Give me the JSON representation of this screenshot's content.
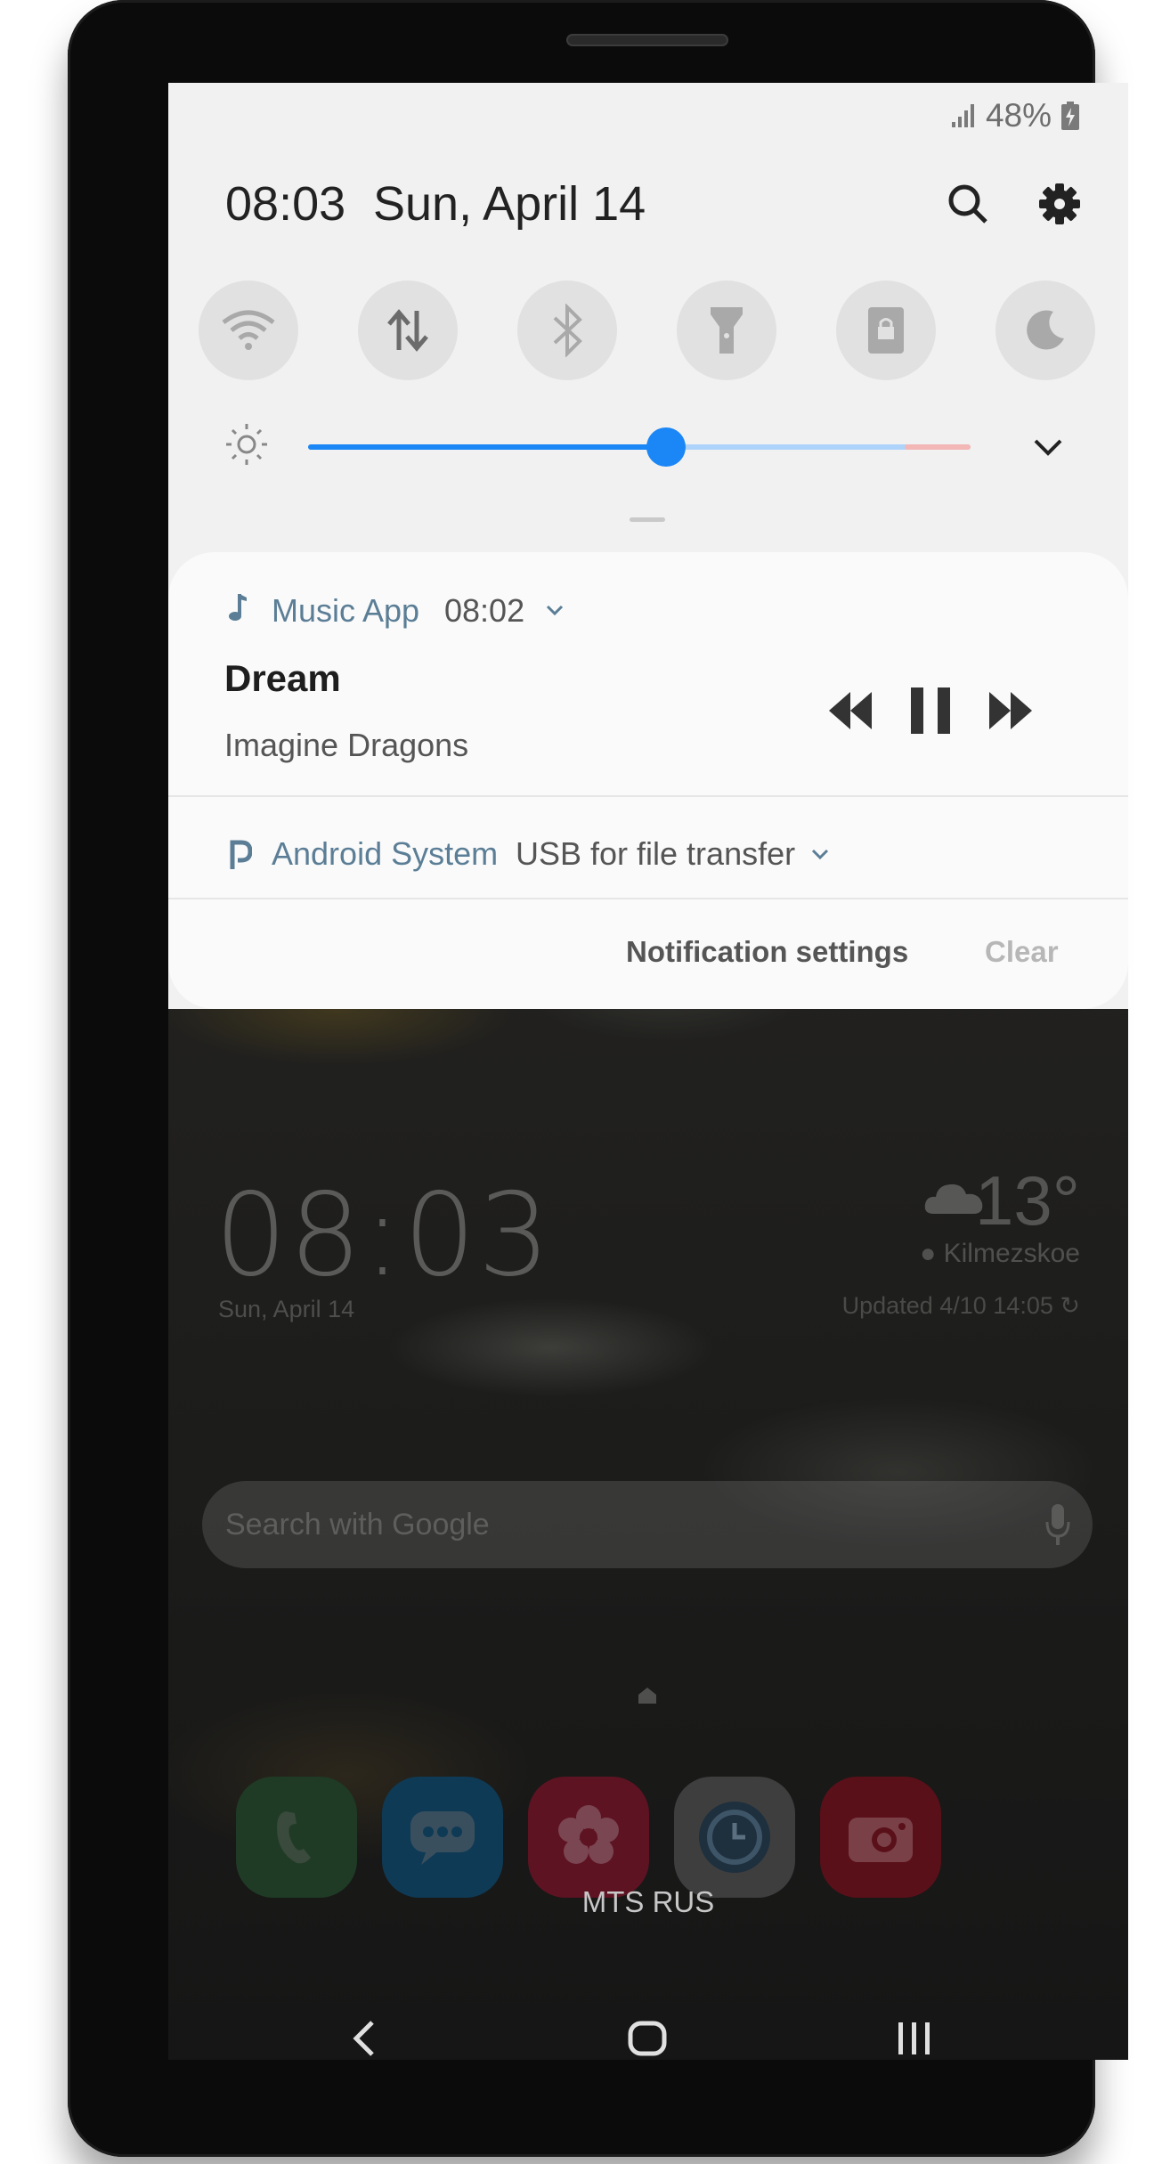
{
  "status_bar": {
    "battery": "48%",
    "signal_icon": "signal-icon",
    "battery_icon": "battery-charging-icon"
  },
  "quick_settings": {
    "time": "08:03",
    "date": "Sun, April 14",
    "search_icon": "search-icon",
    "settings_icon": "gear-icon",
    "tiles": [
      "wifi-icon",
      "mobile-data-icon",
      "bluetooth-icon",
      "flashlight-icon",
      "screen-lock-icon",
      "night-mode-icon"
    ],
    "brightness_level": 0.54,
    "expand_icon": "chevron-down-icon"
  },
  "notifications": [
    {
      "app": "Music App",
      "time": "08:02",
      "title": "Dream",
      "text": "Imagine Dragons",
      "icon": "music-note-icon"
    },
    {
      "app": "Android System",
      "text": "USB for file transfer",
      "icon": "android-system-icon"
    }
  ],
  "notification_actions": {
    "settings": "Notification settings",
    "clear": "Clear"
  },
  "home": {
    "clock": "08:03",
    "date": "Sun, April 14",
    "weather_temp": "13°",
    "weather_location": "Kilmezskoe",
    "weather_updated": "Updated 4/10 14:05",
    "search_placeholder": "Search with Google",
    "carrier": "MTS RUS",
    "dock": [
      "phone-icon",
      "messages-icon",
      "gallery-icon",
      "clock-icon",
      "camera-icon"
    ]
  },
  "colors": {
    "accent": "#1b86f5",
    "app_name": "#5b7e96"
  }
}
